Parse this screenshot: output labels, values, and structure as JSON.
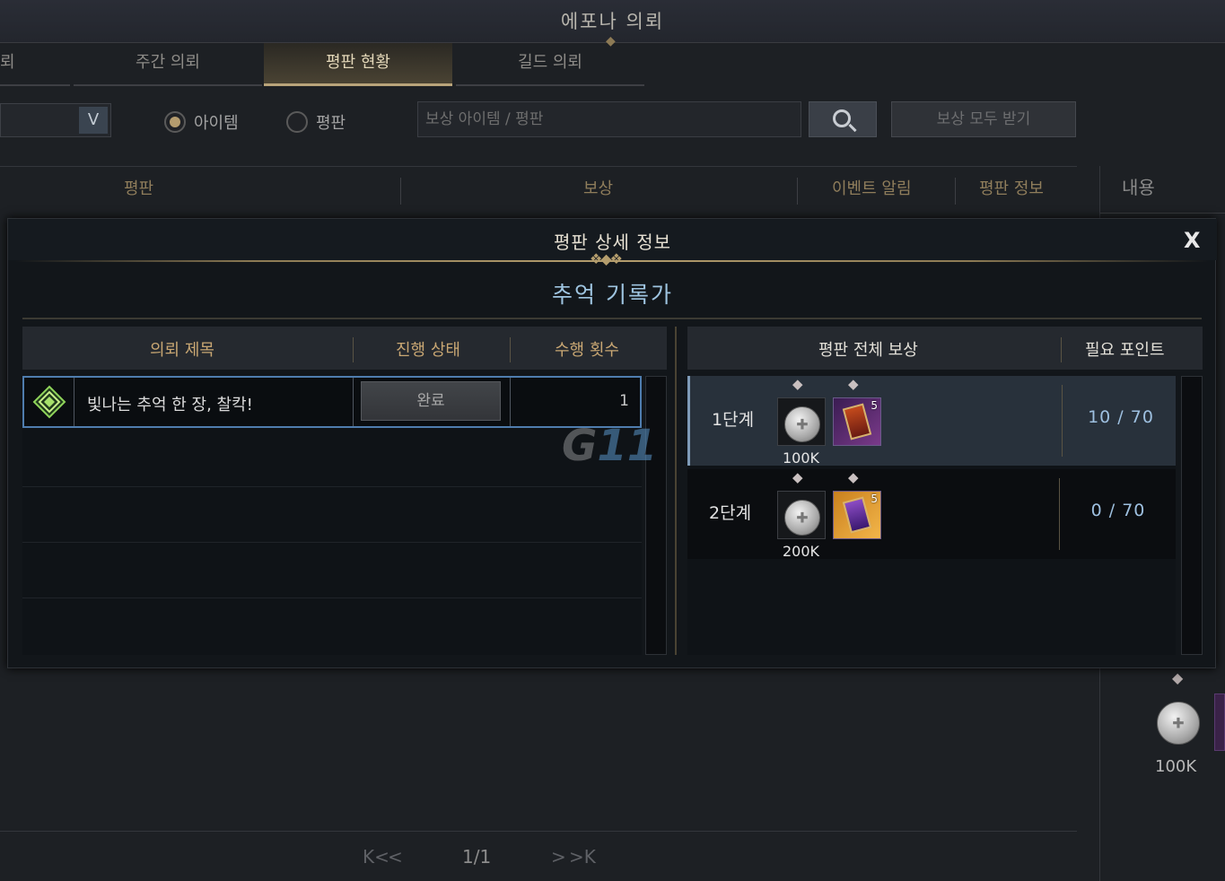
{
  "window": {
    "title": "에포나 의뢰"
  },
  "tabs": [
    {
      "label": "주간 의뢰"
    },
    {
      "label": "평판 현황"
    },
    {
      "label": "길드 의뢰"
    }
  ],
  "tab_partial_left": "뢰",
  "filter": {
    "radio_item": "아이템",
    "radio_rep": "평판",
    "search_placeholder": "보상 아이템 / 평판",
    "claim_all": "보상 모두 받기",
    "dropdown_arrow": "V"
  },
  "list_header": {
    "reputation": "평판",
    "reward": "보상",
    "event_alert": "이벤트 알림",
    "rep_info": "평판 정보"
  },
  "right_panel": {
    "header": "내용",
    "reward_amount": "100K"
  },
  "pager": {
    "first": "K<",
    "prev": "<",
    "page": "1/1",
    "next": ">",
    "last": ">K"
  },
  "modal": {
    "title": "평판 상세 정보",
    "close": "X",
    "subtitle": "추억 기록가",
    "left_header": {
      "title": "의뢰 제목",
      "status": "진행 상태",
      "count": "수행 횟수"
    },
    "quests": [
      {
        "title": "빛나는 추억 한 장, 찰칵!",
        "status": "완료",
        "count": "1"
      }
    ],
    "right_header": {
      "rewards": "평판 전체 보상",
      "points": "필요 포인트"
    },
    "stages": [
      {
        "stage": "1단계",
        "silver": "100K",
        "card_count": "5",
        "points": "10 / 70"
      },
      {
        "stage": "2단계",
        "silver": "200K",
        "card_count": "5",
        "points": "0 / 70"
      }
    ]
  },
  "watermark": {
    "g": "G",
    "rest": "11"
  }
}
